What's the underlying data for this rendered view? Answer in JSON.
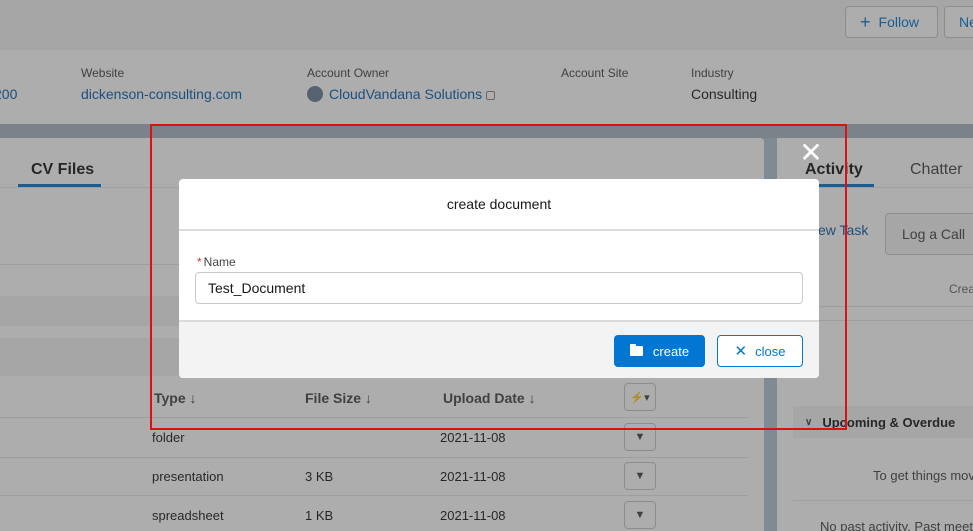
{
  "header": {
    "follow_label": "Follow",
    "new_label": "Ne"
  },
  "fields": {
    "partial_value": "200",
    "website": {
      "label": "Website",
      "value": "dickenson-consulting.com"
    },
    "account_owner": {
      "label": "Account Owner",
      "value": "CloudVandana Solutions"
    },
    "account_site": {
      "label": "Account Site",
      "value": ""
    },
    "industry": {
      "label": "Industry",
      "value": "Consulting"
    }
  },
  "left_panel": {
    "tab_label": "CV Files",
    "columns": [
      "Type ↓",
      "File Size ↓",
      "Upload Date ↓"
    ],
    "rows": [
      {
        "type": "folder",
        "size": "",
        "date": "2021-11-08"
      },
      {
        "type": "presentation",
        "size": "3 KB",
        "date": "2021-11-08"
      },
      {
        "type": "spreadsheet",
        "size": "1 KB",
        "date": "2021-11-08"
      }
    ]
  },
  "right_panel": {
    "tabs": [
      "Activity",
      "Chatter"
    ],
    "new_task_label": "ew Task",
    "log_call_label": "Log a Call",
    "crea_text": "Crea",
    "upcoming_label": "Upcoming & Overdue",
    "empty_text_1": "To get things mov",
    "empty_text_2": "No past activity. Past meet"
  },
  "modal": {
    "title": "create document",
    "name_label": "Name",
    "name_value": "Test_Document",
    "create_label": "create",
    "close_label": "close"
  },
  "colors": {
    "brand": "#0176d3",
    "annotation": "#e01010"
  }
}
